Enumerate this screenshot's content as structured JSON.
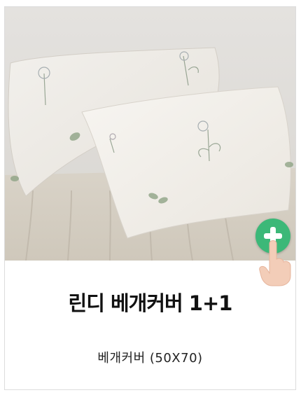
{
  "product": {
    "title": "린디 베개커버 1+1",
    "subtitle": "베개커버 (50X70)"
  },
  "icons": {
    "plus": "plus-circle-icon",
    "hand": "tap-hand-icon"
  },
  "colors": {
    "accent": "#3cb878",
    "hand": "#f3cdb8"
  }
}
